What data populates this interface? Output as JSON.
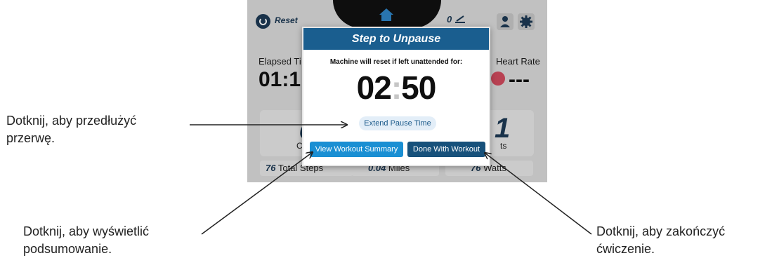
{
  "topbar": {
    "reset_label": "Reset",
    "incline_value": "0",
    "incline_icon": "incline-icon",
    "home_icon": "home-icon",
    "user_icon": "user-icon",
    "settings_icon": "gear-icon"
  },
  "background": {
    "elapsed_label": "Elapsed Ti",
    "elapsed_value": "01:1",
    "heart_rate_label": "Heart Rate",
    "heart_rate_value": "---",
    "calories_label": "Cal",
    "calories_digit": "c",
    "steps_digit": "1",
    "steps_label_fragment": "ts",
    "pills": [
      {
        "value": "76",
        "label": " Total Steps"
      },
      {
        "value": "0.04",
        "label": " Miles"
      },
      {
        "value": "76",
        "label": " Watts"
      }
    ]
  },
  "modal": {
    "title": "Step to Unpause",
    "subtitle": "Machine will reset if left unattended for:",
    "countdown_minutes": "02",
    "countdown_seconds": "50",
    "extend_button": "Extend Pause Time",
    "summary_button": "View Workout Summary",
    "done_button": "Done With Workout"
  },
  "callouts": {
    "extend_line1": "Dotknij, aby przedłużyć",
    "extend_line2": "przerwę.",
    "summary_line1": "Dotknij, aby wyświetlić",
    "summary_line2": "podsumowanie.",
    "done_line1": "Dotknij, aby zakończyć",
    "done_line2": "ćwiczenie."
  },
  "colors": {
    "header_blue": "#1a5e8f",
    "summary_blue": "#1a8fd3",
    "done_blue": "#17517b",
    "heart_red": "#d24b5e"
  }
}
